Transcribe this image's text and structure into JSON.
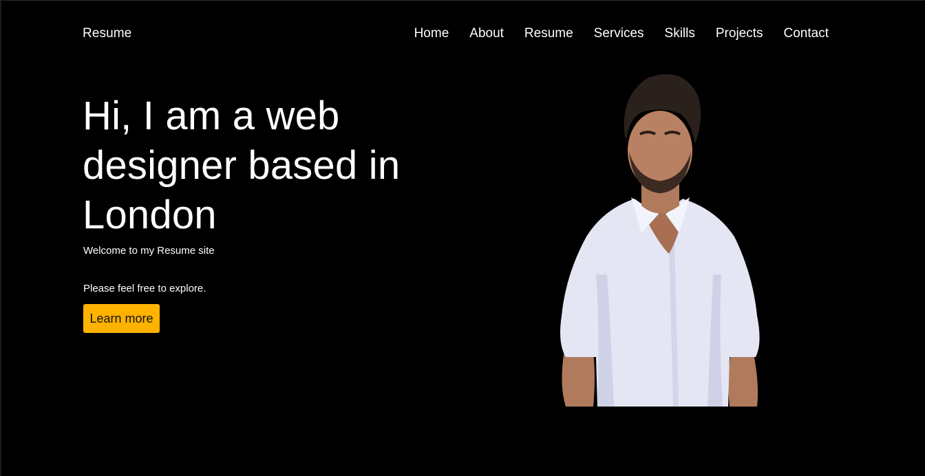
{
  "header": {
    "brand": "Resume",
    "nav": [
      "Home",
      "About",
      "Resume",
      "Services",
      "Skills",
      "Projects",
      "Contact"
    ]
  },
  "hero": {
    "title": "Hi, I am a web designer based in London",
    "welcome": "Welcome to my Resume site",
    "explore": "Please feel free to explore.",
    "cta_label": "Learn more"
  },
  "colors": {
    "background": "#000000",
    "accent": "#ffb300",
    "text": "#ffffff"
  }
}
